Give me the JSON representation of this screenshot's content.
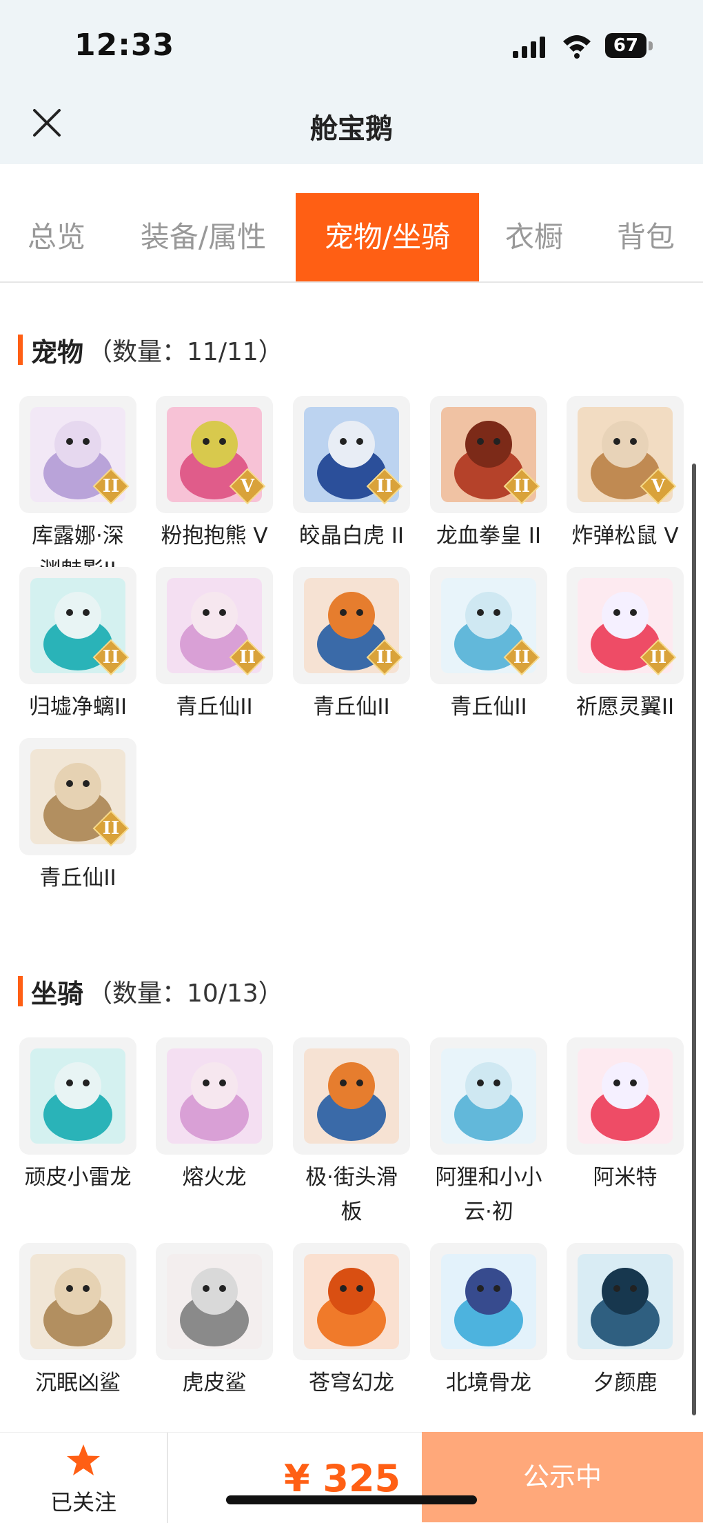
{
  "status": {
    "time": "12:33",
    "battery": "67"
  },
  "header": {
    "title": "舱宝鹅"
  },
  "tabs": [
    {
      "label": "总览"
    },
    {
      "label": "装备/属性"
    },
    {
      "label": "宠物/坐骑"
    },
    {
      "label": "衣橱"
    },
    {
      "label": "背包"
    }
  ],
  "pets": {
    "title": "宠物",
    "count": "（数量：11/11）",
    "items": [
      {
        "name": "库露娜·深渊魅影II",
        "label_lines": [
          "库露娜·深",
          "渊魅影II"
        ],
        "badge": "II"
      },
      {
        "name": "粉抱抱熊 V",
        "label_lines": [
          "粉抱抱熊 V"
        ],
        "badge": "V"
      },
      {
        "name": "皎晶白虎 II",
        "label_lines": [
          "皎晶白虎 II"
        ],
        "badge": "II"
      },
      {
        "name": "龙血拳皇 II",
        "label_lines": [
          "龙血拳皇 II"
        ],
        "badge": "II"
      },
      {
        "name": "炸弹松鼠 V",
        "label_lines": [
          "炸弹松鼠 V"
        ],
        "badge": "V"
      },
      {
        "name": "归墟净螭II",
        "label_lines": [
          "归墟净螭II"
        ],
        "badge": "II"
      },
      {
        "name": "青丘仙II",
        "label_lines": [
          "青丘仙II"
        ],
        "badge": "II"
      },
      {
        "name": "青丘仙II",
        "label_lines": [
          "青丘仙II"
        ],
        "badge": "II"
      },
      {
        "name": "青丘仙II",
        "label_lines": [
          "青丘仙II"
        ],
        "badge": "II"
      },
      {
        "name": "祈愿灵翼II",
        "label_lines": [
          "祈愿灵翼II"
        ],
        "badge": "II"
      },
      {
        "name": "青丘仙II",
        "label_lines": [
          "青丘仙II"
        ],
        "badge": "II"
      }
    ]
  },
  "mounts": {
    "title": "坐骑",
    "count": "（数量：10/13）",
    "items": [
      {
        "name": "顽皮小雷龙",
        "label_lines": [
          "顽皮小雷龙"
        ]
      },
      {
        "name": "熔火龙",
        "label_lines": [
          "熔火龙"
        ]
      },
      {
        "name": "极·街头滑板",
        "label_lines": [
          "极·街头滑",
          "板"
        ]
      },
      {
        "name": "阿狸和小小云·初",
        "label_lines": [
          "阿狸和小小",
          "云·初"
        ]
      },
      {
        "name": "阿米特",
        "label_lines": [
          "阿米特"
        ]
      },
      {
        "name": "沉眠凶鲨",
        "label_lines": [
          "沉眠凶鲨"
        ]
      },
      {
        "name": "虎皮鲨",
        "label_lines": [
          "虎皮鲨"
        ]
      },
      {
        "name": "苍穹幻龙",
        "label_lines": [
          "苍穹幻龙"
        ]
      },
      {
        "name": "北境骨龙",
        "label_lines": [
          "北境骨龙"
        ]
      },
      {
        "name": "夕颜鹿",
        "label_lines": [
          "夕颜鹿"
        ]
      }
    ]
  },
  "bottom": {
    "follow_label": "已关注",
    "price": "¥ 325",
    "cta_label": "公示中"
  },
  "colors": {
    "accent": "#ff5f14",
    "cta": "#ffa87a",
    "header_bg": "#eef4f7"
  }
}
